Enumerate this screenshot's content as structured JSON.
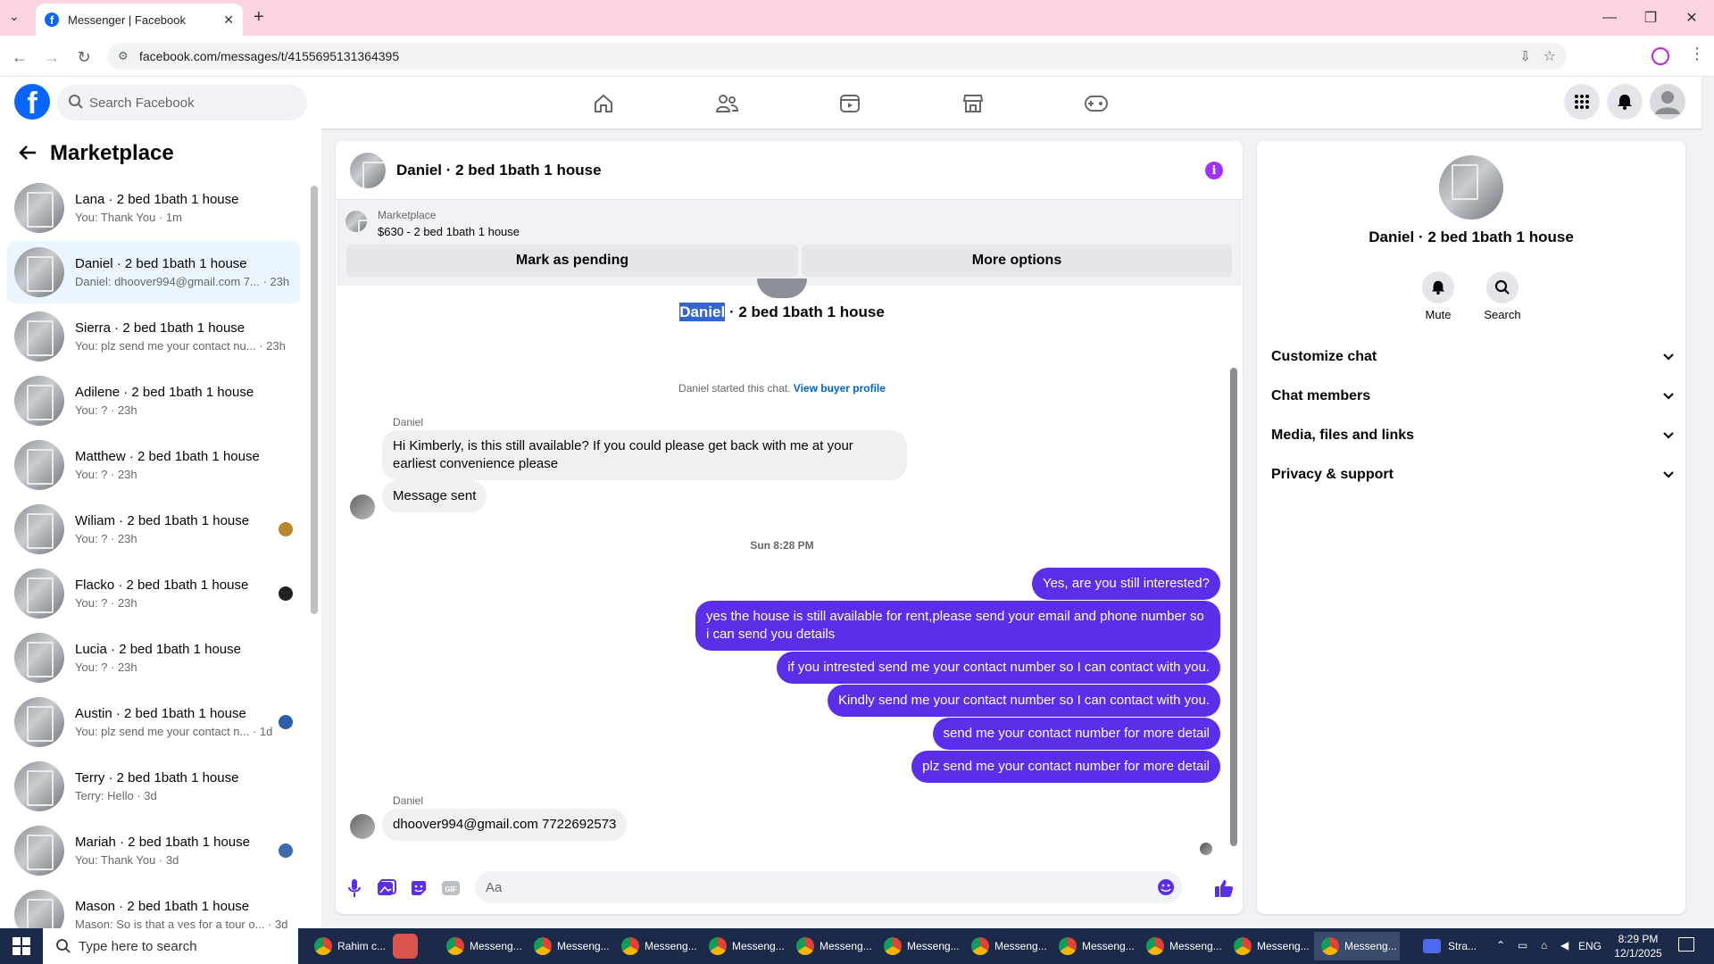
{
  "browser": {
    "tab_title": "Messenger | Facebook",
    "url": "facebook.com/messages/t/4155695131364395"
  },
  "fb": {
    "search_placeholder": "Search Facebook"
  },
  "sidebar": {
    "title": "Marketplace",
    "conversations": [
      {
        "name": "Lana · 2 bed 1bath 1 house",
        "preview": "You: Thank You · 1m"
      },
      {
        "name": "Daniel · 2 bed 1bath 1 house",
        "preview": "Daniel: dhoover994@gmail.com 7... · 23h",
        "active": true
      },
      {
        "name": "Sierra · 2 bed 1bath 1 house",
        "preview": "You: plz send me your contact nu... · 23h"
      },
      {
        "name": "Adilene · 2 bed 1bath 1 house",
        "preview": "You: ? · 23h"
      },
      {
        "name": "Matthew · 2 bed 1bath 1 house",
        "preview": "You: ? · 23h"
      },
      {
        "name": "Wiliam · 2 bed 1bath 1 house",
        "preview": "You: ? · 23h"
      },
      {
        "name": "Flacko · 2 bed 1bath 1 house",
        "preview": "You: ? · 23h"
      },
      {
        "name": "Lucia · 2 bed 1bath 1 house",
        "preview": "You: ? · 23h"
      },
      {
        "name": "Austin · 2 bed 1bath 1 house",
        "preview": "You: plz send me your contact n... · 1d"
      },
      {
        "name": "Terry · 2 bed 1bath 1 house",
        "preview": "Terry: Hello · 3d"
      },
      {
        "name": "Mariah · 2 bed 1bath 1 house",
        "preview": "You: Thank You · 3d"
      },
      {
        "name": "Mason · 2 bed 1bath 1 house",
        "preview": "Mason: So is that a yes for a tour o... · 3d"
      }
    ]
  },
  "chat": {
    "title": "Daniel · 2 bed 1bath 1 house",
    "marketplace_label": "Marketplace",
    "listing": "$630 - 2 bed 1bath 1 house",
    "mark_pending": "Mark as pending",
    "more_options": "More options",
    "intro_name_highlight": "Daniel",
    "intro_name_rest": " · 2 bed 1bath 1 house",
    "started_text": "Daniel started this chat.",
    "view_buyer_profile": "View buyer profile",
    "sender_name": "Daniel",
    "incoming_1": "Hi Kimberly, is this still available? If you could please get back with me at your earliest convenience please",
    "incoming_2": "Message sent",
    "timestamp": "Sun 8:28 PM",
    "outgoing": [
      "Yes, are you still interested?",
      "yes the house is still available for rent,please send your email and phone number so i can send you details",
      "if you intrested send me your contact number so I can contact with you.",
      "Kindly send me your contact number so I can contact with you.",
      "send me your contact number for more detail",
      "plz send me your contact number for more detail"
    ],
    "sender_name_2": "Daniel",
    "incoming_3": "dhoover994@gmail.com 7722692573",
    "composer_placeholder": "Aa"
  },
  "details": {
    "name": "Daniel · 2 bed 1bath 1 house",
    "mute": "Mute",
    "search": "Search",
    "sections": [
      "Customize chat",
      "Chat members",
      "Media, files and links",
      "Privacy & support"
    ]
  },
  "taskbar": {
    "search_placeholder": "Type here to search",
    "apps": [
      "Rahim c...",
      "Messeng...",
      "Messeng...",
      "Messeng...",
      "Messeng...",
      "Messeng...",
      "Messeng...",
      "Messeng...",
      "Messeng...",
      "Messeng...",
      "Messeng...",
      "Messeng..."
    ],
    "stream_app": "Stra...",
    "lang": "ENG",
    "time": "8:29 PM",
    "date": "12/1/2025"
  },
  "colors": {
    "fb_blue": "#0866ff",
    "outgoing_bubble": "#5b2fea",
    "info_purple": "#a033ff"
  }
}
